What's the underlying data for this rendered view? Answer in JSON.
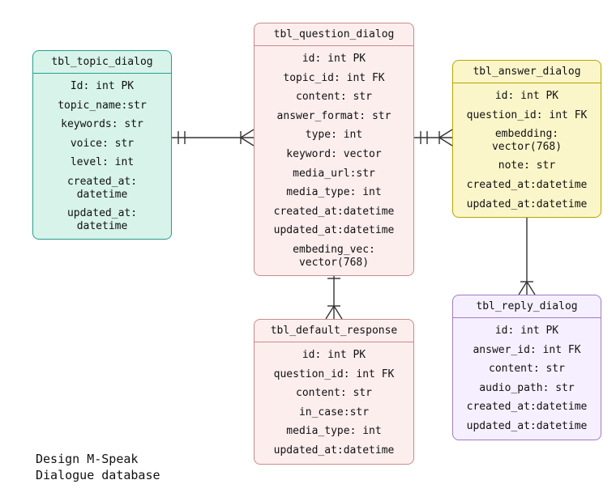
{
  "caption": "Design M-Speak\nDialogue database",
  "entities": {
    "topic": {
      "name": "tbl_topic_dialog",
      "fields": [
        "Id: int PK",
        "topic_name:str",
        "keywords: str",
        "voice: str",
        "level: int",
        "created_at:\ndatetime",
        "updated_at:\ndatetime"
      ]
    },
    "question": {
      "name": "tbl_question_dialog",
      "fields": [
        "id: int PK",
        "topic_id: int FK",
        "content: str",
        "answer_format: str",
        "type: int",
        "keyword: vector",
        "media_url:str",
        "media_type: int",
        "created_at:datetime",
        "updated_at:datetime",
        "embeding_vec:\nvector(768)"
      ]
    },
    "answer": {
      "name": "tbl_answer_dialog",
      "fields": [
        "id: int PK",
        "question_id: int FK",
        "embedding:\nvector(768)",
        "note: str",
        "created_at:datetime",
        "updated_at:datetime"
      ]
    },
    "defaultResponse": {
      "name": "tbl_default_response",
      "fields": [
        "id: int PK",
        "question_id: int FK",
        "content: str",
        "in_case:str",
        "media_type: int",
        "updated_at:datetime"
      ]
    },
    "reply": {
      "name": "tbl_reply_dialog",
      "fields": [
        "id: int PK",
        "answer_id: int FK",
        "content: str",
        "audio_path: str",
        "created_at:datetime",
        "updated_at:datetime"
      ]
    }
  },
  "relationships": [
    {
      "from": "topic",
      "to": "question",
      "fromEnd": "one",
      "toEnd": "many"
    },
    {
      "from": "question",
      "to": "answer",
      "fromEnd": "one",
      "toEnd": "many"
    },
    {
      "from": "question",
      "to": "defaultResponse",
      "fromEnd": "one",
      "toEnd": "many"
    },
    {
      "from": "answer",
      "to": "reply",
      "fromEnd": "one",
      "toEnd": "many"
    }
  ]
}
